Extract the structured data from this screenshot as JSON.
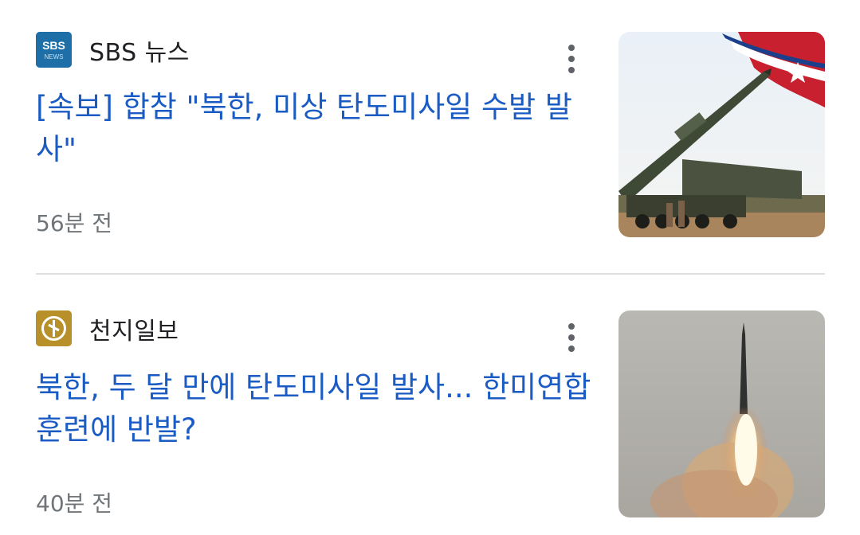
{
  "articles": [
    {
      "source": "SBS 뉴스",
      "logo_text_top": "SBS",
      "logo_text_bottom": "NEWS",
      "headline": "[속보] 합참 \"북한, 미상 탄도미사일 수발 발사\"",
      "time": "56분 전",
      "thumbnail_icon": "missile-launcher-image"
    },
    {
      "source": "천지일보",
      "headline": "북한, 두 달 만에 탄도미사일 발사... 한미연합훈련에 반발?",
      "time": "40분 전",
      "thumbnail_icon": "missile-launch-image"
    }
  ],
  "colors": {
    "headline": "#1a5bc4",
    "source_text": "#202124",
    "time_text": "#70757a",
    "sbs_logo_bg": "#1e6fa8",
    "cheonji_logo_bg": "#b8902a",
    "divider": "#dedede"
  }
}
